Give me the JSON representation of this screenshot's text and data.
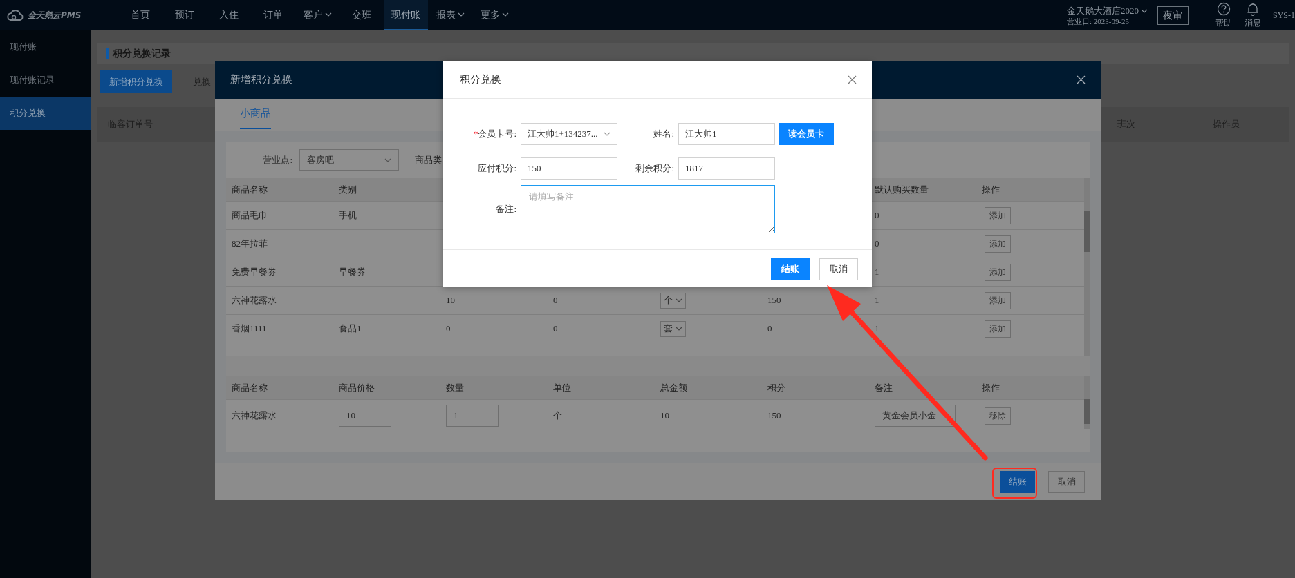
{
  "top_nav": {
    "logo_text": "金天鹅云PMS",
    "menu": [
      {
        "label": "首页",
        "selected": false,
        "dropdown": false
      },
      {
        "label": "预订",
        "selected": false,
        "dropdown": false
      },
      {
        "label": "入住",
        "selected": false,
        "dropdown": false
      },
      {
        "label": "订单",
        "selected": false,
        "dropdown": false
      },
      {
        "label": "客户",
        "selected": false,
        "dropdown": true
      },
      {
        "label": "交班",
        "selected": false,
        "dropdown": false
      },
      {
        "label": "现付账",
        "selected": true,
        "dropdown": false
      },
      {
        "label": "报表",
        "selected": false,
        "dropdown": true
      },
      {
        "label": "更多",
        "selected": false,
        "dropdown": true
      }
    ],
    "hotel": "金天鹅大酒店2020",
    "business_day": "营业日: 2023-09-25",
    "night_audit": "夜审",
    "help": "帮助",
    "messages": "消息",
    "user": "SYS-1"
  },
  "sidebar": {
    "items": [
      {
        "label": "现付账",
        "selected": false
      },
      {
        "label": "现付账记录",
        "selected": false
      },
      {
        "label": "积分兑换",
        "selected": true
      }
    ]
  },
  "page": {
    "title": "积分兑换记录",
    "add_button": "新增积分兑换",
    "filter_label": "兑换",
    "left_columns": [
      "临客订单号"
    ],
    "right_columns": [
      "班次",
      "操作员"
    ]
  },
  "exchange_modal": {
    "title": "新增积分兑换",
    "tabs": [
      {
        "label": "小商品",
        "selected": true
      }
    ],
    "outlet_label": "营业点:",
    "outlet": "客房吧",
    "category_label": "商品类",
    "product_table": {
      "columns": {
        "name": "商品名称",
        "category": "类别",
        "default_qty": "默认购买数量",
        "action": "操作"
      },
      "rows": [
        {
          "name": "商品毛巾",
          "category": "手机",
          "default_qty": "0",
          "action": "添加"
        },
        {
          "name": "82年拉菲",
          "default_qty": "0",
          "action": "添加"
        },
        {
          "name": "免费早餐券",
          "category": "早餐券",
          "default_qty": "1",
          "action": "添加"
        },
        {
          "name": "六神花露水",
          "column_3": "10",
          "column_4": "0",
          "unit": "个",
          "column_6": "150",
          "default_qty": "1",
          "action": "添加"
        },
        {
          "name": "香烟1111",
          "category": "食品1",
          "column_3": "0",
          "column_4": "0",
          "unit": "套",
          "column_6": "0",
          "default_qty": "1",
          "action": "添加"
        }
      ]
    },
    "cart_table": {
      "columns": [
        "商品名称",
        "商品价格",
        "数量",
        "单位",
        "总金额",
        "积分",
        "备注",
        "操作"
      ],
      "rows": [
        {
          "name": "六神花露水",
          "price": "10",
          "quantity": "1",
          "unit": "个",
          "total": "10",
          "points": "150",
          "remark": "黄金会员小金",
          "action": "移除"
        }
      ]
    },
    "checkout_button": "结账",
    "cancel_button": "取消"
  },
  "points_dialog": {
    "title": "积分兑换",
    "member_card_label": "会员卡号:",
    "member_card_required_mark": "*",
    "member_card": "江大帅1+134237...",
    "name_label": "姓名:",
    "name": "江大帅1",
    "read_card_button": "读会员卡",
    "payable_label": "应付积分:",
    "payable": "150",
    "remaining_label": "剩余积分:",
    "remaining": "1817",
    "remark_label": "备注:",
    "remark_placeholder": "请填写备注",
    "checkout_button": "结账",
    "cancel_button": "取消"
  }
}
